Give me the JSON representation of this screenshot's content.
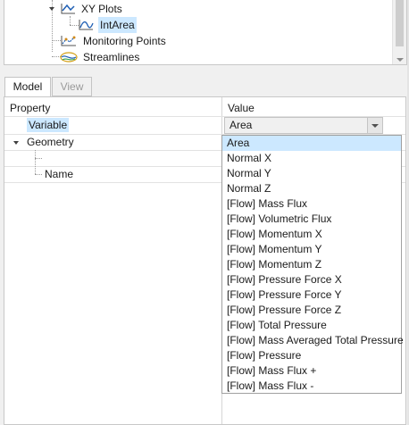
{
  "tree": {
    "items": [
      {
        "label": "XY Plots",
        "icon": "xy-plot-icon"
      },
      {
        "label": "IntArea",
        "icon": "line-plot-icon",
        "selected": true
      },
      {
        "label": "Monitoring Points",
        "icon": "monitor-points-icon"
      },
      {
        "label": "Streamlines",
        "icon": "streamlines-icon"
      }
    ]
  },
  "tabs": {
    "model": "Model",
    "view": "View"
  },
  "grid": {
    "headers": {
      "property": "Property",
      "value": "Value"
    },
    "rows": {
      "variable": {
        "label": "Variable",
        "value": "Area"
      },
      "geometry": {
        "label": "Geometry"
      },
      "name": {
        "label": "Name"
      }
    }
  },
  "dropdown": {
    "selected": "Area",
    "options": [
      "Area",
      "Normal X",
      "Normal Y",
      "Normal Z",
      "[Flow] Mass Flux",
      "[Flow] Volumetric Flux",
      "[Flow] Momentum X",
      "[Flow] Momentum Y",
      "[Flow] Momentum Z",
      "[Flow] Pressure Force X",
      "[Flow] Pressure Force Y",
      "[Flow] Pressure Force Z",
      "[Flow] Total Pressure",
      "[Flow] Mass Averaged Total Pressure",
      "[Flow] Pressure",
      "[Flow] Mass Flux +",
      "[Flow] Mass Flux -"
    ]
  },
  "colors": {
    "selection": "#cce8ff",
    "icon_blue": "#1f5fb4",
    "border": "#c8c8c8"
  }
}
